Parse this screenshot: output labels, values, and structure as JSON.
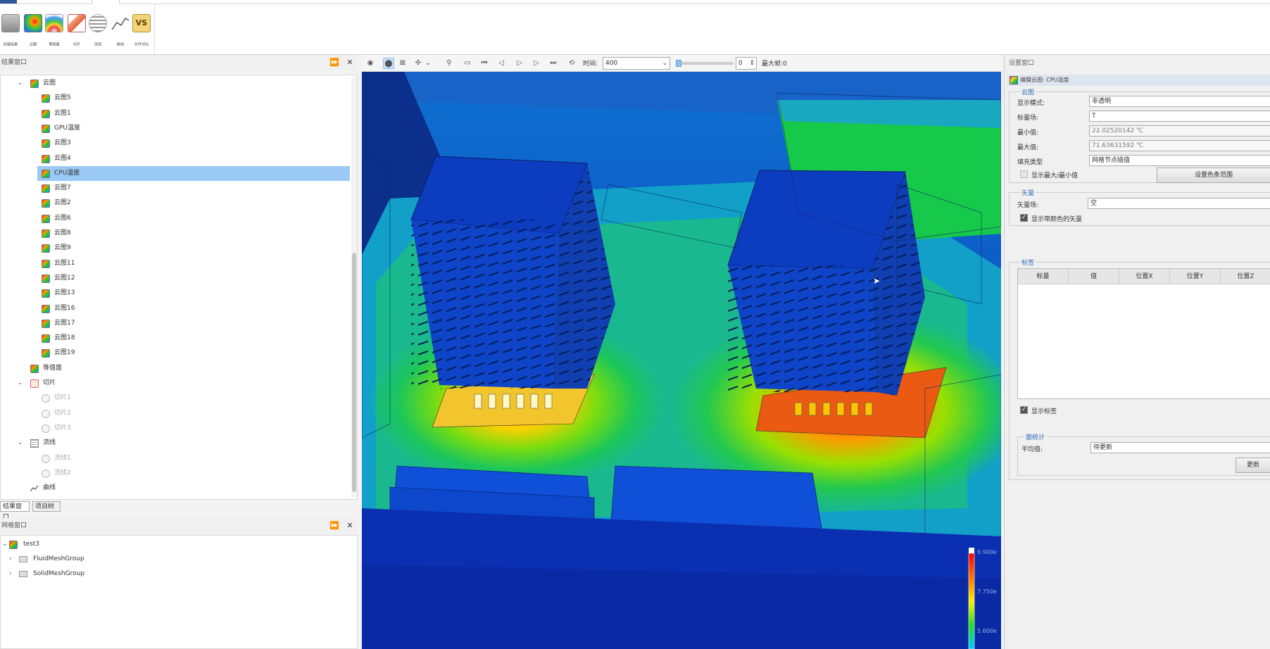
{
  "ribbon": {
    "buttons": [
      {
        "label": "加载结果",
        "icon": "load-results-icon"
      },
      {
        "label": "云图",
        "icon": "contour-icon"
      },
      {
        "label": "等值面",
        "icon": "isosurface-icon"
      },
      {
        "label": "切片",
        "icon": "slice-icon"
      },
      {
        "label": "流线",
        "icon": "streamline-icon"
      },
      {
        "label": "曲线",
        "icon": "curve-icon"
      },
      {
        "label": "文件对比",
        "icon": "vs-compare-icon"
      }
    ]
  },
  "result_panel": {
    "title": "结果窗口",
    "tree": [
      {
        "label": "云图",
        "kind": "cloud",
        "level": 1,
        "expanded": true
      },
      {
        "label": "云图5",
        "kind": "cloud",
        "level": 2
      },
      {
        "label": "云图1",
        "kind": "cloud",
        "level": 2
      },
      {
        "label": "GPU温度",
        "kind": "cloud",
        "level": 2
      },
      {
        "label": "云图3",
        "kind": "cloud",
        "level": 2
      },
      {
        "label": "云图4",
        "kind": "cloud",
        "level": 2
      },
      {
        "label": "CPU温度",
        "kind": "cloud",
        "level": 2,
        "selected": true
      },
      {
        "label": "云图7",
        "kind": "cloud",
        "level": 2
      },
      {
        "label": "云图2",
        "kind": "cloud",
        "level": 2
      },
      {
        "label": "云图6",
        "kind": "cloud",
        "level": 2
      },
      {
        "label": "云图8",
        "kind": "cloud",
        "level": 2
      },
      {
        "label": "云图9",
        "kind": "cloud",
        "level": 2
      },
      {
        "label": "云图11",
        "kind": "cloud",
        "level": 2
      },
      {
        "label": "云图12",
        "kind": "cloud",
        "level": 2
      },
      {
        "label": "云图13",
        "kind": "cloud",
        "level": 2
      },
      {
        "label": "云图16",
        "kind": "cloud",
        "level": 2
      },
      {
        "label": "云图17",
        "kind": "cloud",
        "level": 2
      },
      {
        "label": "云图18",
        "kind": "cloud",
        "level": 2
      },
      {
        "label": "云图19",
        "kind": "cloud",
        "level": 2
      },
      {
        "label": "等值面",
        "kind": "iso",
        "level": 1
      },
      {
        "label": "切片",
        "kind": "slice",
        "level": 1,
        "expanded": true
      },
      {
        "label": "切片1",
        "kind": "grey",
        "level": 2
      },
      {
        "label": "切片2",
        "kind": "grey",
        "level": 2
      },
      {
        "label": "切片3",
        "kind": "grey",
        "level": 2
      },
      {
        "label": "流线",
        "kind": "stream",
        "level": 1,
        "expanded": true
      },
      {
        "label": "流线1",
        "kind": "grey",
        "level": 2
      },
      {
        "label": "流线2",
        "kind": "grey",
        "level": 2
      },
      {
        "label": "曲线",
        "kind": "line",
        "level": 1
      }
    ],
    "tabs": [
      "结果窗口",
      "项目树"
    ]
  },
  "mesh_panel": {
    "title": "网格窗口",
    "tree": [
      {
        "label": "test3",
        "level": 0,
        "expanded": true
      },
      {
        "label": "FluidMeshGroup",
        "level": 1
      },
      {
        "label": "SolidMeshGroup",
        "level": 1
      }
    ]
  },
  "viewer_toolbar": {
    "time_label": "时间:",
    "time_value": "400",
    "frame_value": "0",
    "max_frame": "最大帧:0"
  },
  "legend": {
    "ticks": [
      "9.900e",
      "7.750e",
      "5.600e"
    ]
  },
  "settings_panel": {
    "title": "设置窗口",
    "subtitle": "编辑云图: CPU温度",
    "cloud_group": {
      "title": "云图",
      "display_mode_label": "显示模式:",
      "display_mode": "非透明",
      "scalar_label": "标量场:",
      "scalar": "T",
      "min_label": "最小值:",
      "min": "22.02520142 ℃",
      "max_label": "最大值:",
      "max": "71.63631592 ℃",
      "fill_label": "填充类型",
      "fill": "网格节点插值",
      "show_minmax": "显示最大/最小值",
      "color_range_button": "设置色条范围"
    },
    "vector_group": {
      "title": "矢量",
      "vector_label": "矢量场:",
      "vector": "空",
      "show_colored_vector": "显示带颜色的矢量"
    },
    "label_group": {
      "title": "标签",
      "columns": [
        "标量",
        "值",
        "位置X",
        "位置Y",
        "位置Z"
      ],
      "show_labels": "显示标签"
    },
    "surface_group": {
      "title": "面统计",
      "avg_label": "平均值:",
      "avg": "待更新",
      "update_button": "更新"
    }
  }
}
